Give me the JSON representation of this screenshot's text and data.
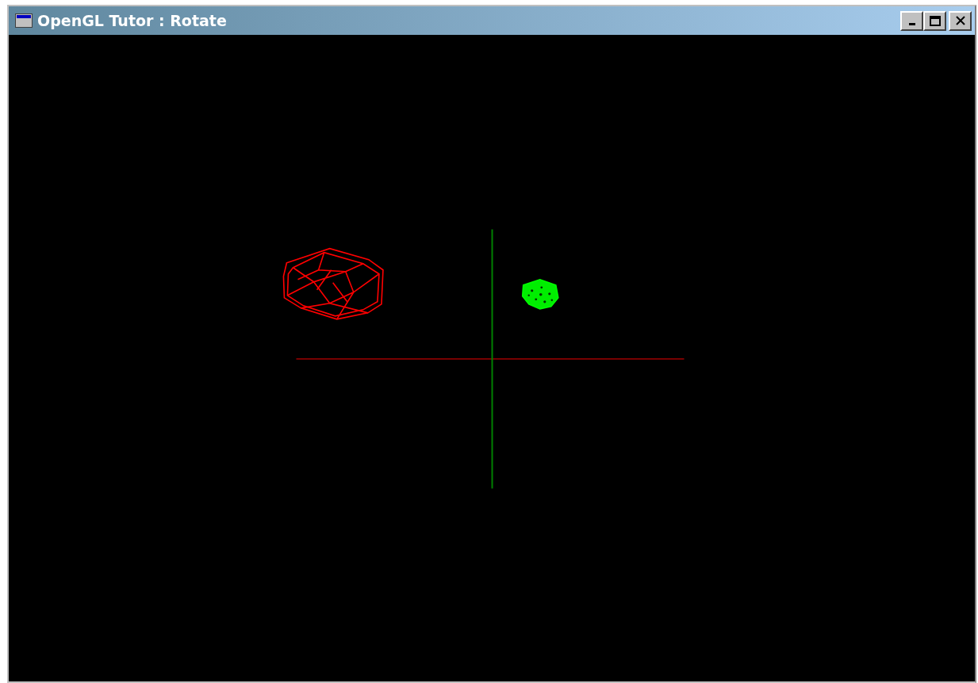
{
  "window": {
    "title": "OpenGL Tutor : Rotate"
  }
}
